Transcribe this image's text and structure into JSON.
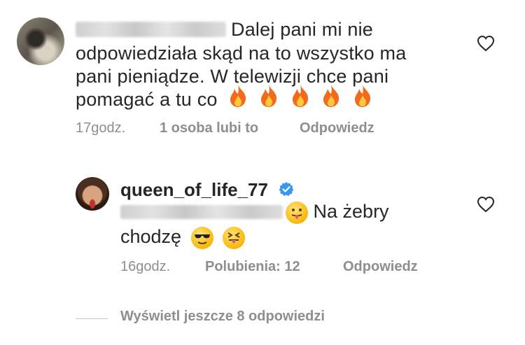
{
  "comment": {
    "username_blurred": "",
    "lines": [
      "Dalej pani mi nie",
      "odpowiedziała skąd na to wszystko ma",
      "pani pieniądze. W telewizji chce pani",
      "pomagać a tu co"
    ],
    "emoji_trail": [
      "fire-icon",
      "fire-icon",
      "fire-icon",
      "fire-icon",
      "fire-icon"
    ],
    "time": "17godz.",
    "likes": "1 osoba lubi to",
    "reply_label": "Odpowiedz"
  },
  "reply": {
    "username": "queen_of_life_77",
    "verified": true,
    "text_part_1": "Na żebry",
    "text_part_2": "chodzę",
    "emoji_inline": "tongue-wink-icon",
    "emoji_end": [
      "sunglasses-face-icon",
      "squint-tongue-face-icon"
    ],
    "time": "16godz.",
    "likes": "Polubienia: 12",
    "reply_label": "Odpowiedz"
  },
  "view_more": "Wyświetl jeszcze 8 odpowiedzi",
  "colors": {
    "text": "#262626",
    "muted": "#8e8e8e",
    "verified": "#3897f0",
    "fire": "#f26b1d"
  }
}
